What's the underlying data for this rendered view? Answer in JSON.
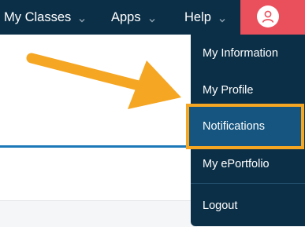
{
  "topnav": {
    "my_classes": "My Classes",
    "apps": "Apps",
    "help": "Help"
  },
  "user_menu": {
    "items": [
      {
        "label": "My Information"
      },
      {
        "label": "My Profile"
      },
      {
        "label": "Notifications"
      },
      {
        "label": "My ePortfolio"
      },
      {
        "label": "Logout"
      }
    ],
    "highlighted_index": 2
  },
  "icons": {
    "caret": "chevron-down-icon",
    "avatar": "user-icon",
    "annotation": "arrow-icon"
  },
  "colors": {
    "nav_bg": "#0b2f47",
    "avatar_bg": "#e9505c",
    "highlight_border": "#f5a623",
    "arrow": "#f5a623",
    "highlight_bg": "#15557f",
    "accent_line": "#1c78b8"
  }
}
